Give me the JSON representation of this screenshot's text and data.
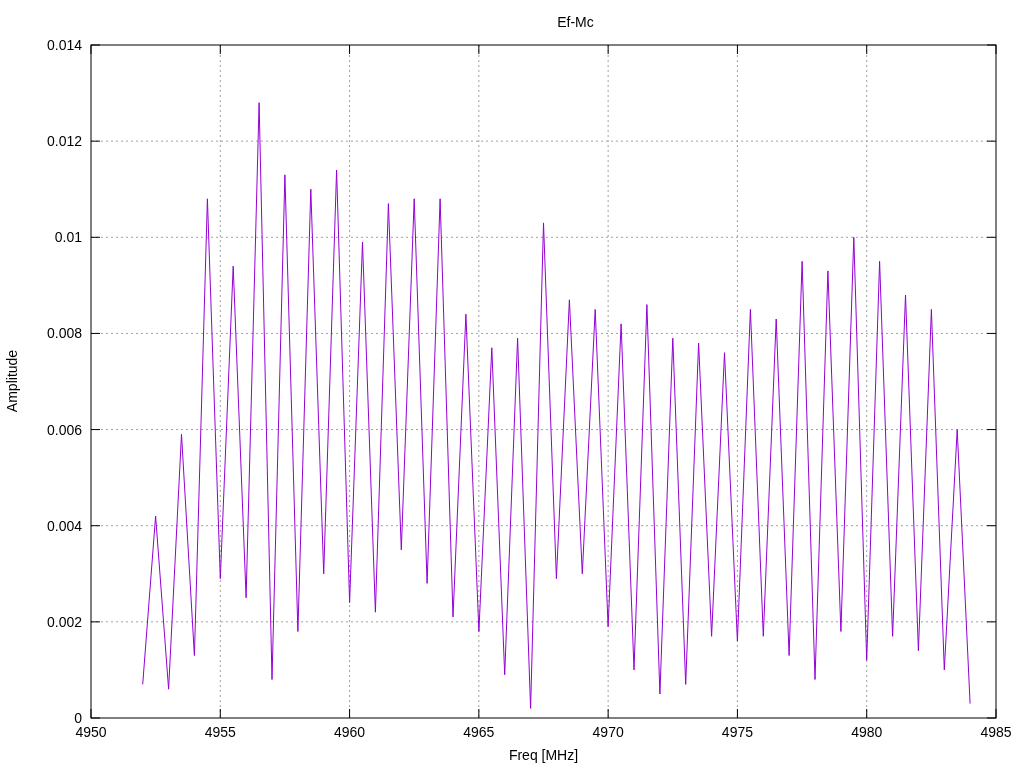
{
  "plot": {
    "chart_data": {
      "type": "line",
      "grid": true,
      "title": "Ef-Mc",
      "xlabel": "Freq [MHz]",
      "ylabel": "Amplitude",
      "xlim": [
        4950,
        4985
      ],
      "ylim": [
        0,
        0.014
      ],
      "xticks": [
        4950,
        4955,
        4960,
        4965,
        4970,
        4975,
        4980,
        4985
      ],
      "yticks": [
        0,
        0.002,
        0.004,
        0.006,
        0.008,
        0.01,
        0.012,
        0.014
      ],
      "x": [
        4952,
        4952.5,
        4953,
        4953.5,
        4954,
        4954.5,
        4955,
        4955.5,
        4956,
        4956.5,
        4957,
        4957.5,
        4958,
        4958.5,
        4959,
        4959.5,
        4960,
        4960.5,
        4961,
        4961.5,
        4962,
        4962.5,
        4963,
        4963.5,
        4964,
        4964.5,
        4965,
        4965.5,
        4966,
        4966.5,
        4967,
        4967.5,
        4968,
        4968.5,
        4969,
        4969.5,
        4970,
        4970.5,
        4971,
        4971.5,
        4972,
        4972.5,
        4973,
        4973.5,
        4974,
        4974.5,
        4975,
        4975.5,
        4976,
        4976.5,
        4977,
        4977.5,
        4978,
        4978.5,
        4979,
        4979.5,
        4980,
        4980.5,
        4981,
        4981.5,
        4982,
        4982.5,
        4983,
        4983.5,
        4984
      ],
      "series": [
        {
          "color": "#9400d3",
          "values": [
            0.0007,
            0.0042,
            0.0006,
            0.0059,
            0.0013,
            0.0108,
            0.0029,
            0.0094,
            0.0025,
            0.0128,
            0.0008,
            0.0113,
            0.0018,
            0.011,
            0.003,
            0.0114,
            0.0024,
            0.0099,
            0.0022,
            0.0107,
            0.0035,
            0.0108,
            0.0028,
            0.0108,
            0.0021,
            0.0084,
            0.0018,
            0.0077,
            0.0009,
            0.0079,
            0.0002,
            0.0103,
            0.0029,
            0.0087,
            0.003,
            0.0085,
            0.0019,
            0.0082,
            0.001,
            0.0086,
            0.0005,
            0.0079,
            0.0007,
            0.0078,
            0.0017,
            0.0076,
            0.0016,
            0.0085,
            0.0017,
            0.0083,
            0.0013,
            0.0095,
            0.0008,
            0.0093,
            0.0018,
            0.01,
            0.0012,
            0.0095,
            0.0017,
            0.0088,
            0.0014,
            0.0085,
            0.001,
            0.006,
            0.0003
          ]
        }
      ]
    }
  }
}
